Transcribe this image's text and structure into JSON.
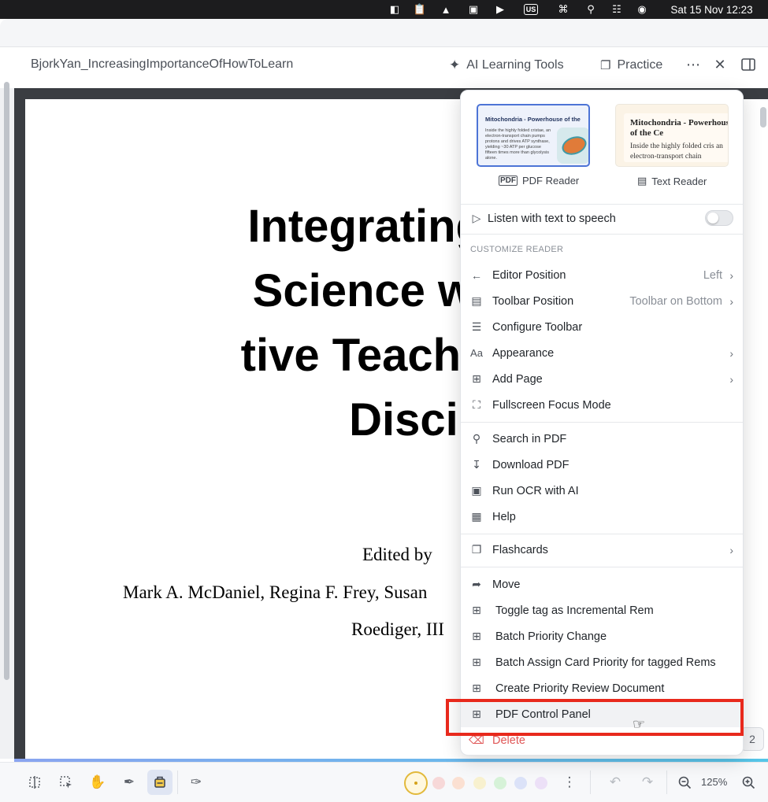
{
  "menubar": {
    "date_time": "Sat 15 Nov  12:23",
    "input_source": "US"
  },
  "header": {
    "doc_title": "BjorkYan_IncreasingImportanceOfHowToLearn",
    "ai_tools_label": "AI Learning Tools",
    "practice_label": "Practice"
  },
  "pdf": {
    "title_lines": [
      "Integrating C",
      "Science with",
      "tive Teaching",
      "Disciplir"
    ],
    "edited_by": "Edited by",
    "editors_line": "Mark A. McDaniel, Regina F. Frey, Susan",
    "editors_line2": "Roediger, III"
  },
  "menu": {
    "pdf_reader_label": "PDF Reader",
    "text_reader_label": "Text Reader",
    "pdf_card_title": "Mitochondria - Powerhouse of the",
    "pdf_card_body": "Inside the highly folded cristae, an electron-transport chain pumps protons and drives ATP synthase, yielding ~30 ATP per glucose fifteen times more than glycolysis alone.",
    "text_card_title": "Mitochondria - Powerhouse of the Ce",
    "text_card_body": "Inside the highly folded cris an electron-transport chain",
    "tts_label": "Listen with text to speech",
    "tts_enabled": false,
    "section_label": "CUSTOMIZE READER",
    "items": {
      "editor_position": "Editor Position",
      "editor_position_value": "Left",
      "toolbar_position": "Toolbar Position",
      "toolbar_position_value": "Toolbar on Bottom",
      "configure_toolbar": "Configure Toolbar",
      "appearance": "Appearance",
      "add_page": "Add Page",
      "fullscreen": "Fullscreen Focus Mode",
      "search_pdf": "Search in PDF",
      "download_pdf": "Download PDF",
      "run_ocr": "Run OCR with AI",
      "help": "Help",
      "flashcards": "Flashcards",
      "move": "Move",
      "toggle_tag": "Toggle tag as Incremental Rem",
      "batch_priority": "Batch Priority Change",
      "batch_assign": "Batch Assign Card Priority for tagged Rems",
      "create_priority": "Create Priority Review Document",
      "pdf_control_panel": "PDF Control Panel",
      "delete": "Delete"
    }
  },
  "toolbar": {
    "zoom": "125%",
    "page_badge": "2",
    "colors": [
      "#f7d8d8",
      "#fbe0d2",
      "#f8f1cf",
      "#d6f2d8",
      "#dbe2f8",
      "#ece0f7"
    ],
    "active_color": "#f2c94c"
  },
  "colors": {
    "accent": "#4d74d6",
    "highlight": "#e8291c",
    "danger": "#e05757"
  }
}
